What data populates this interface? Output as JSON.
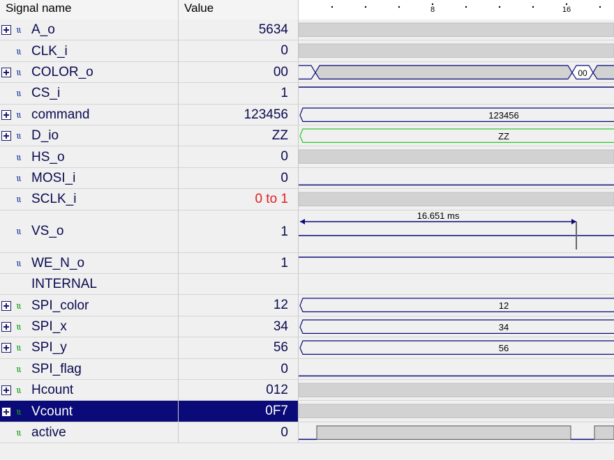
{
  "header": {
    "name_col": "Signal name",
    "value_col": "Value",
    "tick_labels": [
      "8",
      "16"
    ]
  },
  "signals": [
    {
      "label": "A_o",
      "value": "5634",
      "expandable": true,
      "icon": "blue",
      "wave": "bus-gray"
    },
    {
      "label": "CLK_i",
      "value": "0",
      "expandable": false,
      "icon": "blue",
      "wave": "bus-gray"
    },
    {
      "label": "COLOR_o",
      "value": "00",
      "expandable": true,
      "icon": "blue",
      "wave": "color",
      "wave_label": "00"
    },
    {
      "label": "CS_i",
      "value": "1",
      "expandable": false,
      "icon": "blue",
      "wave": "high"
    },
    {
      "label": "command",
      "value": "123456",
      "expandable": true,
      "icon": "blue",
      "wave": "bus-label",
      "wave_label": "123456"
    },
    {
      "label": "D_io",
      "value": "ZZ",
      "expandable": true,
      "icon": "blue",
      "wave": "bus-green",
      "wave_label": "ZZ"
    },
    {
      "label": "HS_o",
      "value": "0",
      "expandable": false,
      "icon": "blue",
      "wave": "bus-gray"
    },
    {
      "label": "MOSI_i",
      "value": "0",
      "expandable": false,
      "icon": "blue",
      "wave": "low"
    },
    {
      "label": "SCLK_i",
      "value": "0 to 1",
      "value_color": "#e02020",
      "expandable": false,
      "icon": "blue",
      "wave": "bus-gray"
    },
    {
      "label": "VS_o",
      "value": "1",
      "expandable": false,
      "icon": "blue",
      "wave": "measure",
      "wave_label": "16.651 ms",
      "tall": true
    },
    {
      "label": "WE_N_o",
      "value": "1",
      "expandable": false,
      "icon": "blue",
      "wave": "high"
    },
    {
      "label": "INTERNAL",
      "value": "",
      "expandable": false,
      "icon": "none",
      "wave": "none"
    },
    {
      "label": "SPI_color",
      "value": "12",
      "expandable": true,
      "icon": "green",
      "wave": "bus-label",
      "wave_label": "12"
    },
    {
      "label": "SPI_x",
      "value": "34",
      "expandable": true,
      "icon": "green",
      "wave": "bus-label",
      "wave_label": "34"
    },
    {
      "label": "SPI_y",
      "value": "56",
      "expandable": true,
      "icon": "green",
      "wave": "bus-label",
      "wave_label": "56"
    },
    {
      "label": "SPI_flag",
      "value": "0",
      "expandable": false,
      "icon": "green",
      "wave": "low"
    },
    {
      "label": "Hcount",
      "value": "012",
      "expandable": true,
      "icon": "green",
      "wave": "bus-gray"
    },
    {
      "label": "Vcount",
      "value": "0F7",
      "expandable": true,
      "icon": "green",
      "wave": "bus-gray",
      "selected": true
    },
    {
      "label": "active",
      "value": "0",
      "expandable": false,
      "icon": "green",
      "wave": "active"
    }
  ]
}
